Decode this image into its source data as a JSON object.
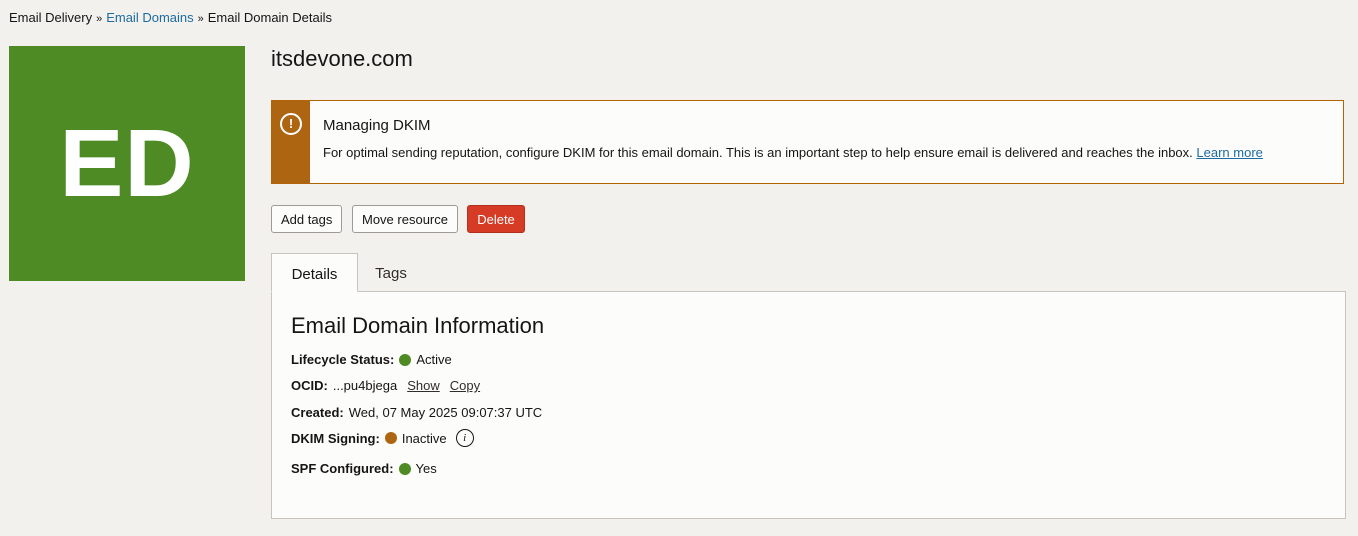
{
  "breadcrumb": {
    "items": [
      "Email Delivery",
      "Email Domains",
      "Email Domain Details"
    ],
    "separator": "»"
  },
  "tile": {
    "initials": "ED",
    "color": "#4e8b24"
  },
  "page_title": "itsdevone.com",
  "banner": {
    "icon": "warning-icon",
    "heading": "Managing DKIM",
    "message": "For optimal sending reputation, configure DKIM for this email domain. This is an important step to help ensure email is delivered and reaches the inbox.",
    "link": "Learn more",
    "color": "#ad6511"
  },
  "actions": {
    "add_tags": "Add tags",
    "move_resource": "Move resource",
    "delete": "Delete"
  },
  "tabs": [
    {
      "label": "Details",
      "active": true
    },
    {
      "label": "Tags",
      "active": false
    }
  ],
  "info": {
    "heading": "Email Domain Information",
    "lifecycle": {
      "label": "Lifecycle Status:",
      "value": "Active",
      "color": "#4e8b24"
    },
    "ocid": {
      "label": "OCID:",
      "value": "...pu4bjega",
      "show": "Show",
      "copy": "Copy"
    },
    "created": {
      "label": "Created:",
      "value": "Wed, 07 May 2025 09:07:37 UTC"
    },
    "dkim": {
      "label": "DKIM Signing:",
      "value": "Inactive",
      "color": "#ad6511",
      "icon": "info-icon"
    },
    "spf": {
      "label": "SPF Configured:",
      "value": "Yes",
      "color": "#4e8b24"
    }
  }
}
